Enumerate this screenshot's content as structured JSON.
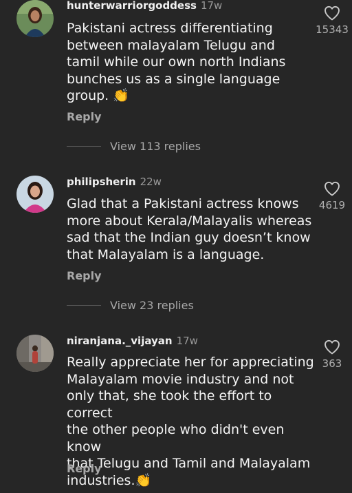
{
  "comments": [
    {
      "username": "hunterwarriorgoddess",
      "time": "17w",
      "text": "Pakistani actress differentiating\nbetween malayalam Telugu and\ntamil while our own north Indians\nbunches us as a single language\ngroup. 👏",
      "reply_label": "Reply",
      "view_replies": "View 113 replies",
      "likes": "15343"
    },
    {
      "username": "philipsherin",
      "time": "22w",
      "text": "Glad that a Pakistani actress knows\nmore about Kerala/Malayalis whereas\nsad that the Indian guy doesn’t know\nthat Malayalam is a language.",
      "reply_label": "Reply",
      "view_replies": "View 23 replies",
      "likes": "4619"
    },
    {
      "username": "niranjana._vijayan",
      "time": "17w",
      "text": "Really appreciate her for appreciating\nMalayalam movie industry and not\nonly that, she took the effort to correct\nthe other people who didn't even know\nthat Telugu and Tamil and Malayalam\nindustries.👏",
      "reply_label": "Reply",
      "likes": "363"
    }
  ],
  "icons": {
    "like": "heart-outline-icon"
  },
  "colors": {
    "background": "#262626",
    "primary_text": "#f2f2f2",
    "secondary_text": "#a8a8a8"
  }
}
